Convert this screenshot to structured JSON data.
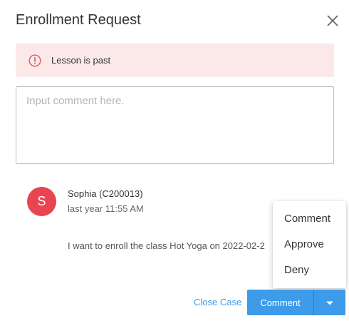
{
  "dialog": {
    "title": "Enrollment Request",
    "close_icon": "close-icon"
  },
  "alert": {
    "icon": "alert-circle-icon",
    "text": "Lesson is past",
    "background": "#fbe9ea",
    "icon_color": "#e0565b"
  },
  "comment_input": {
    "placeholder": "Input comment here.",
    "value": ""
  },
  "entry": {
    "avatar_letter": "S",
    "avatar_color": "#e84452",
    "author": "Sophia (C200013)",
    "time": "last year 11:55 AM",
    "message": "I want to enroll the class Hot Yoga on 2022-02-2"
  },
  "menu": {
    "items": [
      "Comment",
      "Approve",
      "Deny"
    ]
  },
  "footer": {
    "close_case_label": "Close Case",
    "comment_button_label": "Comment",
    "caret_icon": "caret-down-icon",
    "accent": "#3d9be9"
  }
}
